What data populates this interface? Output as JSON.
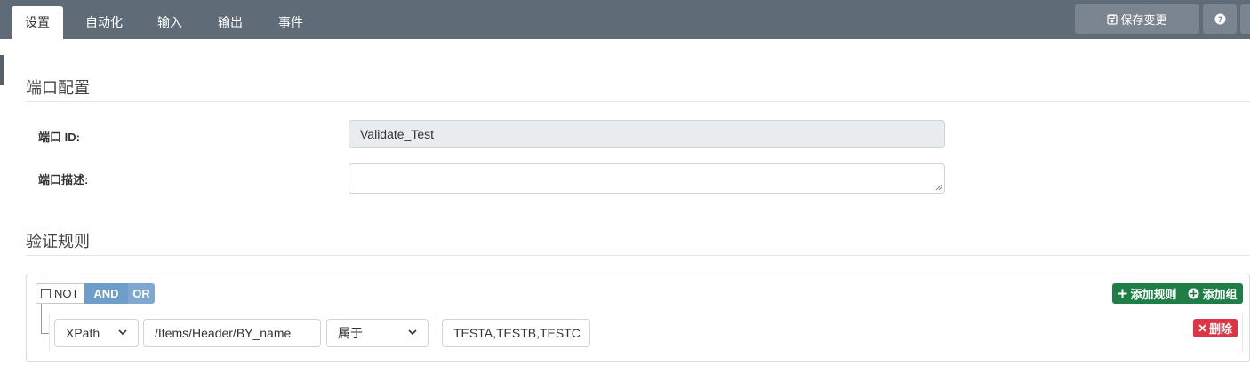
{
  "tabs": [
    {
      "label": "设置",
      "active": true
    },
    {
      "label": "自动化",
      "active": false
    },
    {
      "label": "输入",
      "active": false
    },
    {
      "label": "输出",
      "active": false
    },
    {
      "label": "事件",
      "active": false
    }
  ],
  "toolbar": {
    "save_label": "保存变更",
    "save_icon": "floppy-disk-icon",
    "help_icon": "question-circle-icon"
  },
  "port_config": {
    "title": "端口配置",
    "id_label": "端口 ID:",
    "id_value": "Validate_Test",
    "desc_label": "端口描述:",
    "desc_value": ""
  },
  "validation": {
    "title": "验证规则",
    "not_label": "NOT",
    "and_label": "AND",
    "or_label": "OR",
    "add_rule_label": "添加规则",
    "add_group_label": "添加组",
    "rule": {
      "field": "XPath",
      "path": "/Items/Header/BY_name",
      "operator": "属于",
      "value": "TESTA,TESTB,TESTC",
      "delete_label": "删除"
    }
  },
  "colors": {
    "topbar": "#5f6b77",
    "add_buttons": "#1e7e46",
    "delete_button": "#dc3545",
    "logic_buttons": "#6f9dc9"
  }
}
